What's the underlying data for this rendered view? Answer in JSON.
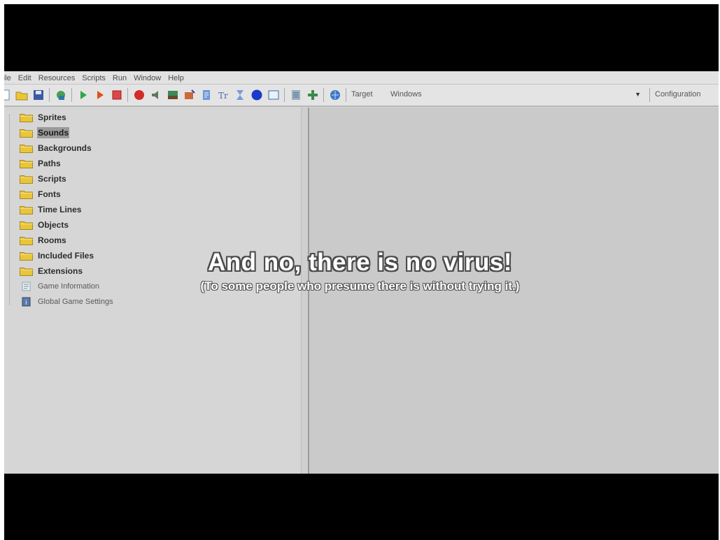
{
  "menu": [
    "File",
    "Edit",
    "Resources",
    "Scripts",
    "Run",
    "Window",
    "Help"
  ],
  "toolbar": {
    "target_label": "Target",
    "target_value": "Windows",
    "config_label": "Configuration"
  },
  "tree": {
    "items": [
      {
        "label": "Sprites"
      },
      {
        "label": "Sounds"
      },
      {
        "label": "Backgrounds"
      },
      {
        "label": "Paths"
      },
      {
        "label": "Scripts"
      },
      {
        "label": "Fonts"
      },
      {
        "label": "Time Lines"
      },
      {
        "label": "Objects"
      },
      {
        "label": "Rooms"
      },
      {
        "label": "Included Files"
      },
      {
        "label": "Extensions"
      },
      {
        "label": "Game Information"
      },
      {
        "label": "Global Game Settings"
      }
    ],
    "selected_index": 1
  },
  "captions": {
    "main": "And no, there is no virus!",
    "sub": "(To some people who presume there is without trying it.)"
  },
  "colors": {
    "folder": "#e8c63a",
    "folder_edge": "#a8861c",
    "letterbox": "#000000",
    "window_bg": "#d4d4d4"
  }
}
